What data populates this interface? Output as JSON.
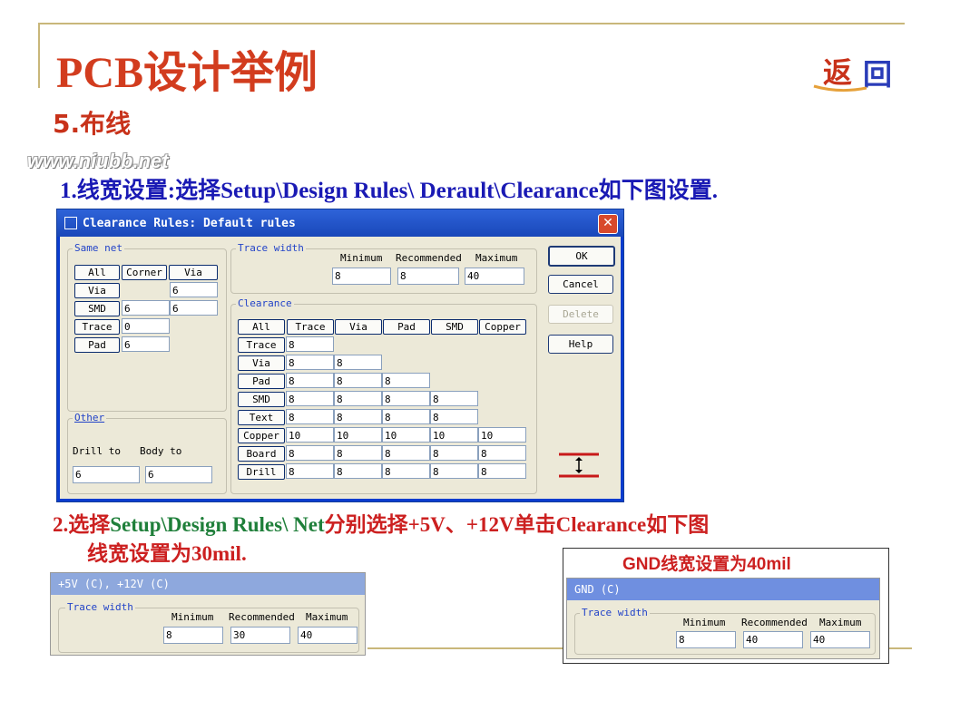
{
  "slide": {
    "title": "PCB设计举例",
    "section": "5.布线",
    "watermark": "www.niubb.net",
    "return_label": "返回",
    "step1": "1.线宽设置:选择Setup\\Design Rules\\ Derault\\Clearance如下图设置.",
    "step2_a": "2.选择",
    "step2_b": "Setup\\Design Rules\\ Net",
    "step2_c": "分别选择+5V、+12V单击Clearance如下图",
    "step2_line2": "线宽设置为30mil.",
    "gnd_caption": "GND线宽设置为40mil"
  },
  "dialog": {
    "title": "Clearance Rules: Default rules",
    "close": "✕",
    "same_net": {
      "label": "Same net",
      "header_buttons": [
        "All",
        "Corner",
        "Via"
      ],
      "rows": [
        {
          "label": "Via",
          "values": [
            "",
            "6"
          ]
        },
        {
          "label": "SMD",
          "values": [
            "6",
            "6"
          ]
        },
        {
          "label": "Trace",
          "values": [
            "0",
            ""
          ]
        },
        {
          "label": "Pad",
          "values": [
            "6",
            ""
          ]
        }
      ]
    },
    "other": {
      "label": "Other",
      "drill_label": "Drill to",
      "body_label": "Body to",
      "drill_value": "6",
      "body_value": "6"
    },
    "trace_width": {
      "label": "Trace width",
      "min_label": "Minimum",
      "rec_label": "Recommended",
      "max_label": "Maximum",
      "min": "8",
      "rec": "8",
      "max": "40"
    },
    "clearance": {
      "label": "Clearance",
      "columns": [
        "All",
        "Trace",
        "Via",
        "Pad",
        "SMD",
        "Copper"
      ],
      "rows": [
        {
          "label": "Trace",
          "values": [
            "8"
          ]
        },
        {
          "label": "Via",
          "values": [
            "8",
            "8"
          ]
        },
        {
          "label": "Pad",
          "values": [
            "8",
            "8",
            "8"
          ]
        },
        {
          "label": "SMD",
          "values": [
            "8",
            "8",
            "8",
            "8"
          ]
        },
        {
          "label": "Text",
          "values": [
            "8",
            "8",
            "8",
            "8"
          ]
        },
        {
          "label": "Copper",
          "values": [
            "10",
            "10",
            "10",
            "10",
            "10"
          ]
        },
        {
          "label": "Board",
          "values": [
            "8",
            "8",
            "8",
            "8",
            "8"
          ]
        },
        {
          "label": "Drill",
          "values": [
            "8",
            "8",
            "8",
            "8",
            "8"
          ]
        }
      ]
    },
    "buttons": {
      "ok": "OK",
      "cancel": "Cancel",
      "delete": "Delete",
      "help": "Help"
    }
  },
  "panel_net": {
    "title": "+5V  (C), +12V  (C)",
    "group_label": "Trace width",
    "min_label": "Minimum",
    "rec_label": "Recommended",
    "max_label": "Maximum",
    "min": "8",
    "rec": "30",
    "max": "40"
  },
  "panel_gnd": {
    "title": "GND  (C)",
    "group_label": "Trace width",
    "min_label": "Minimum",
    "rec_label": "Recommended",
    "max_label": "Maximum",
    "min": "8",
    "rec": "40",
    "max": "40"
  },
  "colors": {
    "title_red": "#d23c1e",
    "step_blue": "#1a1ab4",
    "step_red": "#cc2020",
    "dialog_blue": "#0a3ccf"
  }
}
